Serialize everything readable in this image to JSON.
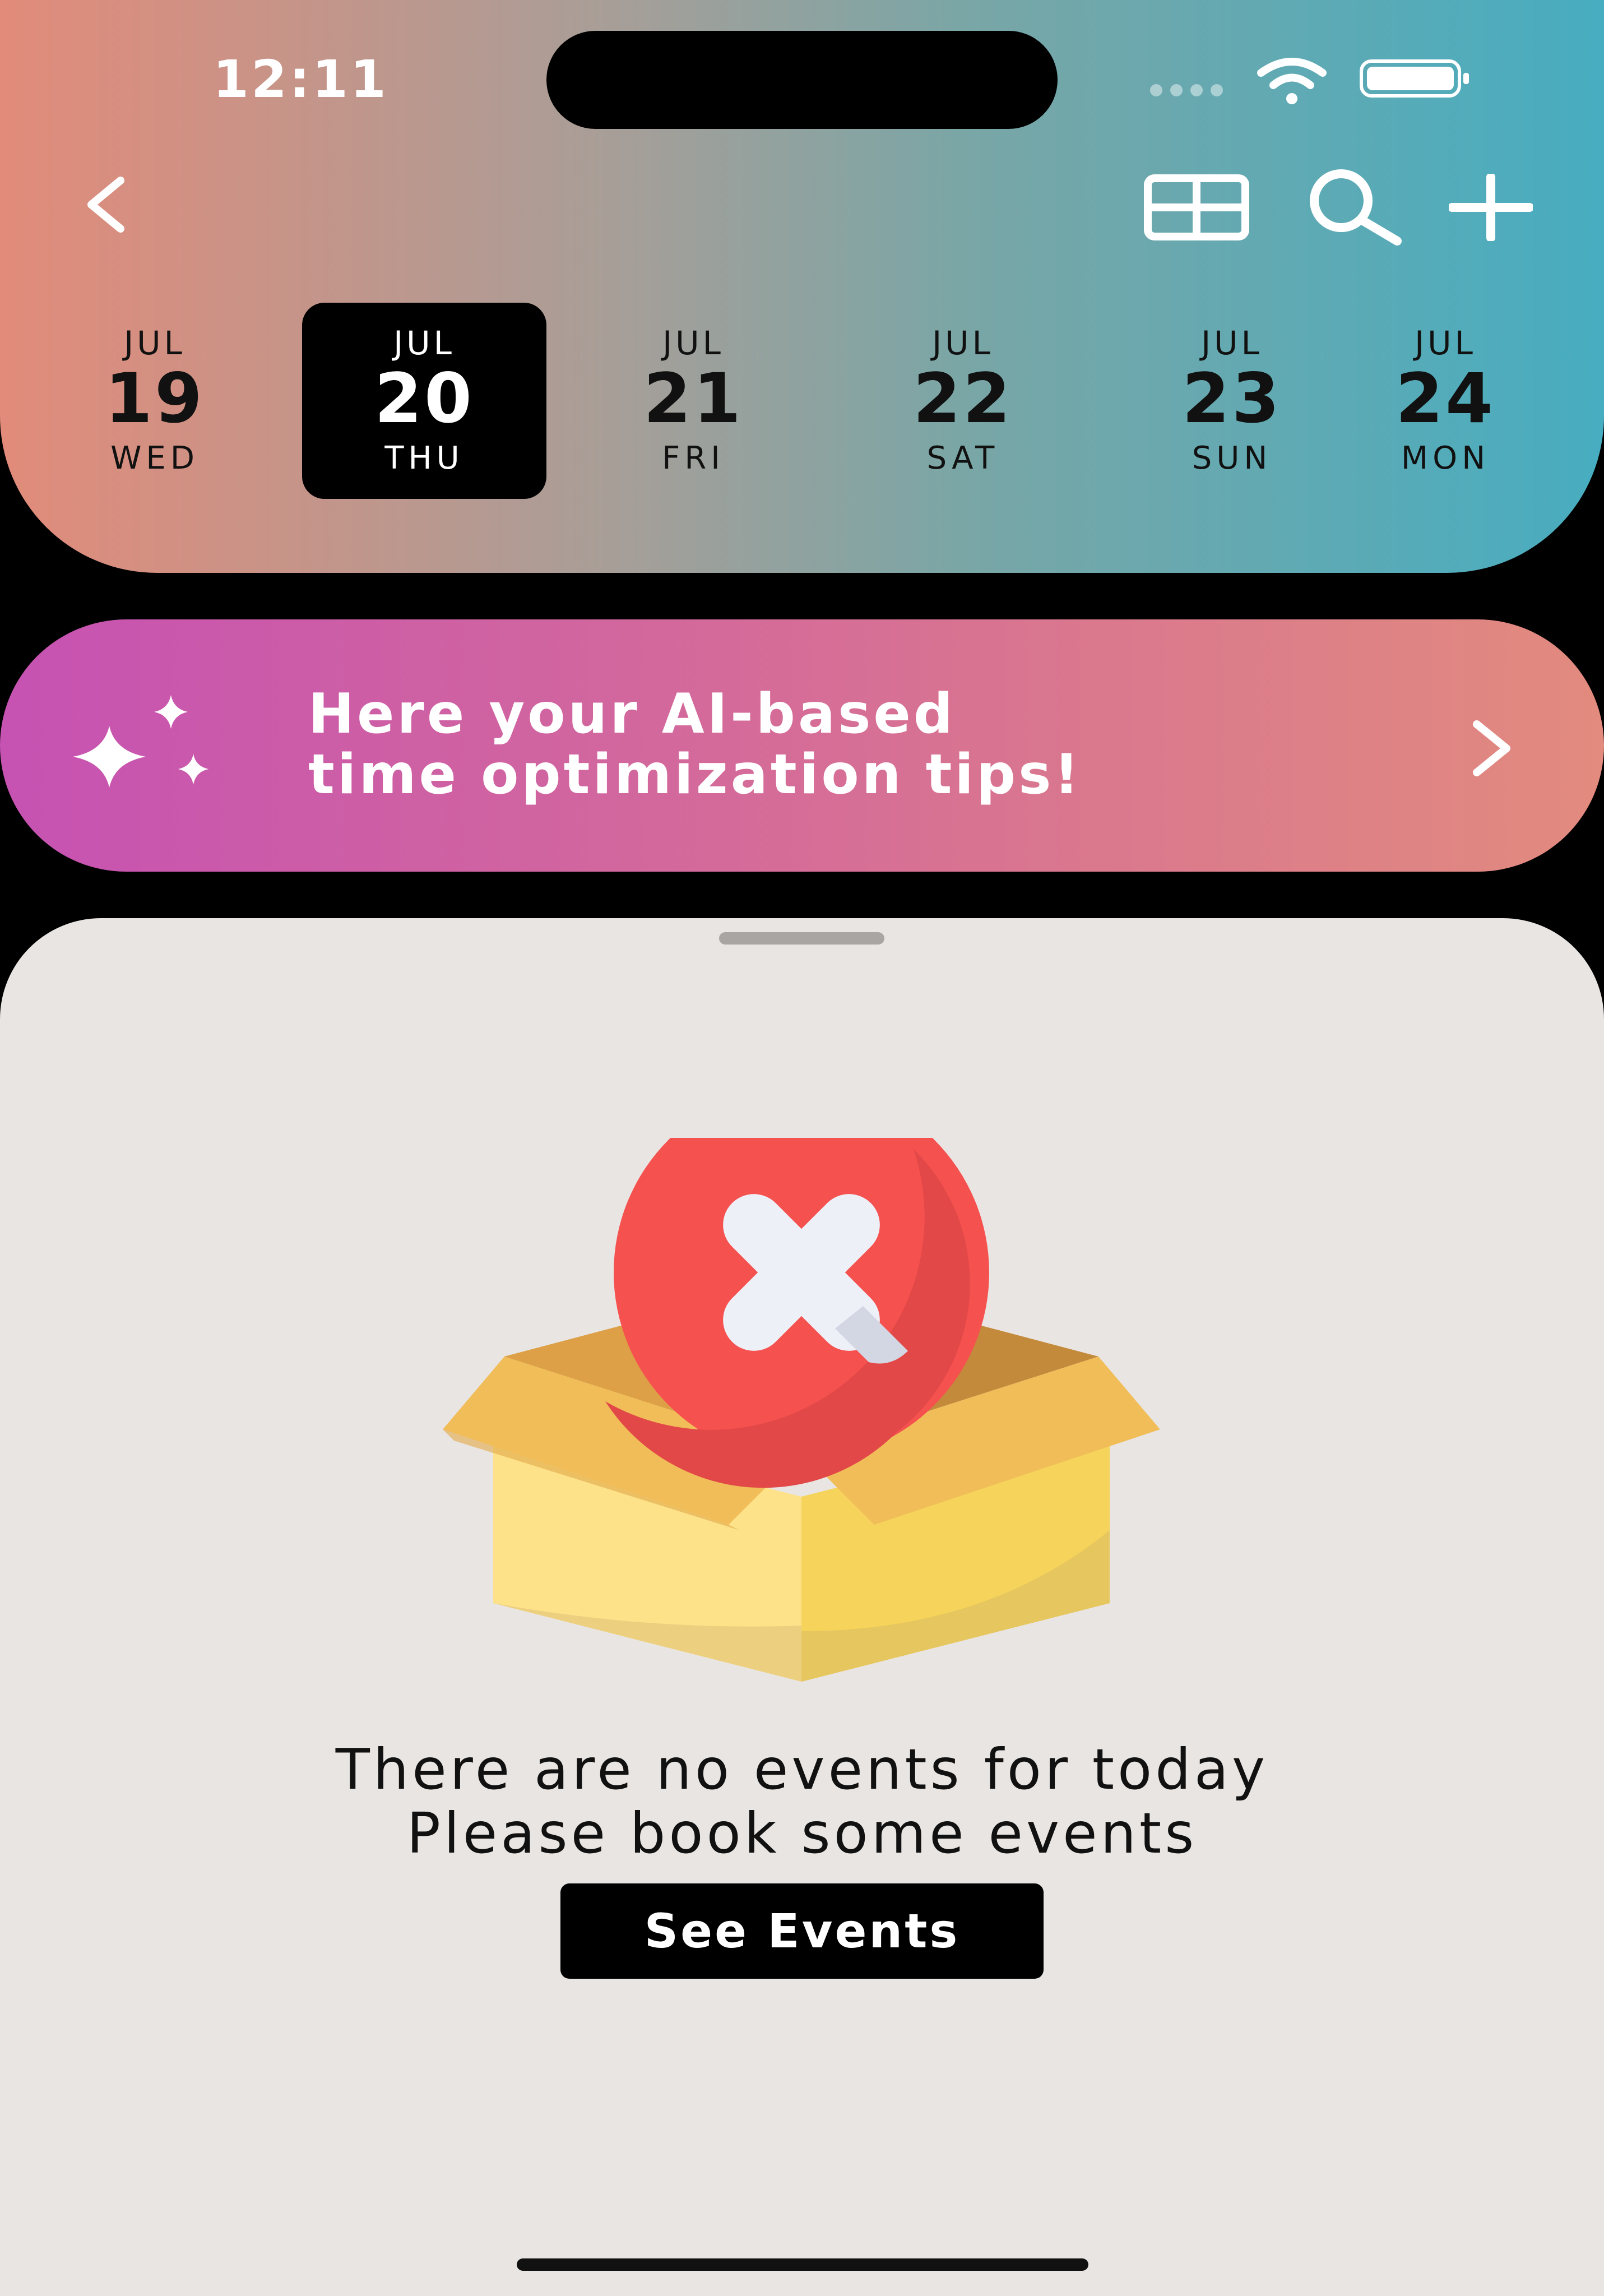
{
  "status_bar": {
    "time": "12:11"
  },
  "dates": [
    {
      "month": "JUL",
      "day": "19",
      "weekday": "WED",
      "selected": false
    },
    {
      "month": "JUL",
      "day": "20",
      "weekday": "THU",
      "selected": true
    },
    {
      "month": "JUL",
      "day": "21",
      "weekday": "FRI",
      "selected": false
    },
    {
      "month": "JUL",
      "day": "22",
      "weekday": "SAT",
      "selected": false
    },
    {
      "month": "JUL",
      "day": "23",
      "weekday": "SUN",
      "selected": false
    },
    {
      "month": "JUL",
      "day": "24",
      "weekday": "MON",
      "selected": false
    }
  ],
  "toolbar": {
    "icons": [
      "back-icon",
      "grid-icon",
      "search-icon",
      "plus-icon"
    ]
  },
  "ai_banner": {
    "line1": "Here your AI-based",
    "line2": "time optimization tips!",
    "icon": "sparkle-icon"
  },
  "empty_state": {
    "title": "There are no events for today",
    "subtitle": "Please book some events",
    "button_label": "See Events",
    "illustration": "empty-box-with-x"
  },
  "colors": {
    "header_gradient_start": "#e28b7a",
    "header_gradient_end": "#47adc0",
    "banner_gradient_start": "#c652b2",
    "banner_gradient_end": "#e28b7e",
    "sheet_background": "#e9e5e2",
    "selected_date_bg": "#000000"
  }
}
